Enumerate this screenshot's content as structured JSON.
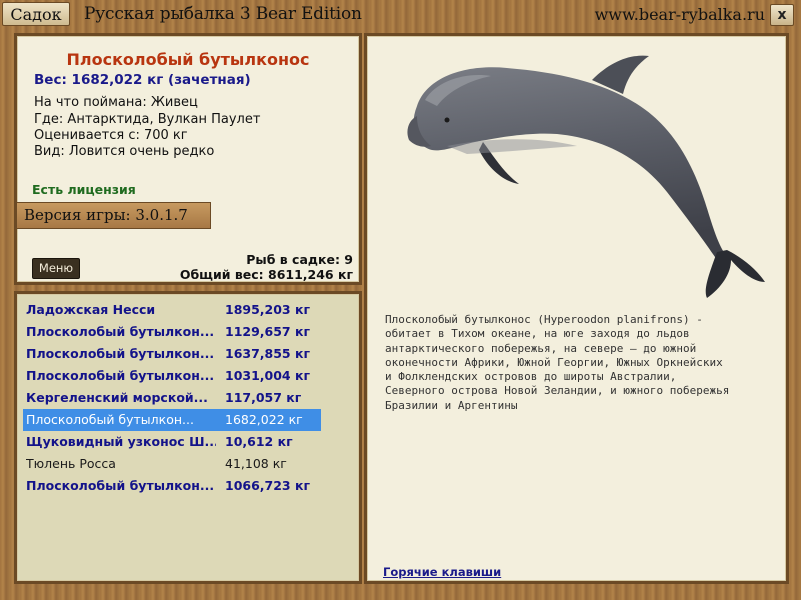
{
  "titlebar": {
    "sadok_button": "Садок",
    "app_title": "Русская рыбалка 3 Bear Edition",
    "site": "www.bear-rybalka.ru",
    "close_label": "x"
  },
  "info": {
    "fish_name": "Плосколобый бутылконос",
    "weight": "Вес: 1682,022 кг (зачетная)",
    "caught_on": "На что поймана: Живец",
    "location": "Где: Антарктида, Вулкан Паулет",
    "valued_from": "Оценивается с: 700 кг",
    "rarity": "Вид: Ловится очень редко",
    "license": "Есть лицензия",
    "version": "Версия игры: 3.0.1.7",
    "menu_button": "Меню",
    "fish_count": "Рыб в садке: 9",
    "total_weight": "Общий вес: 8611,246 кг"
  },
  "catch_list": [
    {
      "name": "Ладожская Несси",
      "weight": "1895,203 кг",
      "style": "bold"
    },
    {
      "name": "Плосколобый бутылкон...",
      "weight": "1129,657 кг",
      "style": "bold"
    },
    {
      "name": "Плосколобый бутылкон...",
      "weight": "1637,855 кг",
      "style": "bold"
    },
    {
      "name": "Плосколобый бутылкон...",
      "weight": "1031,004 кг",
      "style": "bold"
    },
    {
      "name": "Кергеленский морской...",
      "weight": "117,057 кг",
      "style": "bold"
    },
    {
      "name": "Плосколобый бутылкон...",
      "weight": "1682,022 кг",
      "style": "selected"
    },
    {
      "name": "Щуковидный узконос Ш...",
      "weight": "10,612 кг",
      "style": "bold"
    },
    {
      "name": "Тюлень Росса",
      "weight": "41,108 кг",
      "style": "plain"
    },
    {
      "name": "Плосколобый бутылкон...",
      "weight": "1066,723 кг",
      "style": "bold"
    }
  ],
  "detail": {
    "image_icon": "dolphin-image",
    "description": "Плосколобый бутылконос (Hyperoodon planifrons) -\nобитает в Тихом океане, на юге заходя до льдов\nантарктического побережья, на севере – до южной\nоконечности Африки, Южной Георгии, Южных Оркнейских\nи Фолклендских островов до широты Австралии,\nСеверного острова Новой Зеландии, и южного побережья\nБразилии и Аргентины",
    "hotkeys_link": "Горячие клавиши"
  },
  "colors": {
    "fish_name": "#b83510",
    "weight_text": "#1a1a8a",
    "license": "#1f6b1f",
    "selection": "#3f8ee6"
  }
}
